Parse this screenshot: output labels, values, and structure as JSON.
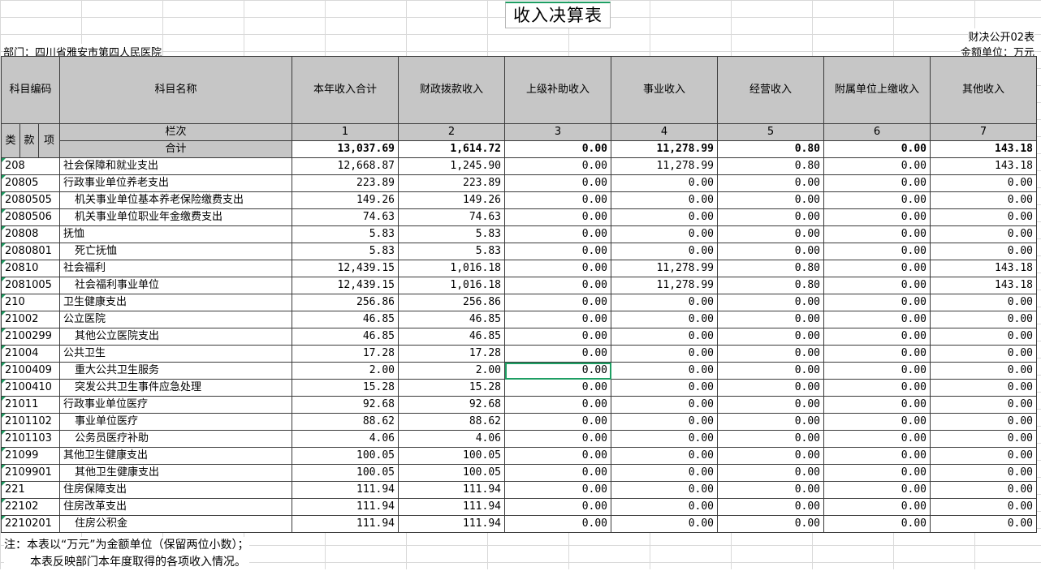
{
  "title": "收入决算表",
  "form_code": "财决公开02表",
  "department": "部门：四川省雅安市第四人民医院",
  "unit": "金额单位：万元",
  "headers": {
    "subject_code": "科目编码",
    "subject_name": "科目名称",
    "total": "本年收入合计",
    "fiscal": "财政拨款收入",
    "superior": "上级补助收入",
    "business": "事业收入",
    "operation": "经营收入",
    "affiliate": "附属单位上缴收入",
    "other": "其他收入",
    "lei": "类",
    "kuan": "款",
    "xiang": "项",
    "column_no": "栏次",
    "col1": "1",
    "col2": "2",
    "col3": "3",
    "col4": "4",
    "col5": "5",
    "col6": "6",
    "col7": "7"
  },
  "total_row": {
    "label": "合计",
    "values": [
      "13,037.69",
      "1,614.72",
      "0.00",
      "11,278.99",
      "0.80",
      "0.00",
      "143.18"
    ]
  },
  "rows": [
    {
      "code": "208",
      "name": "社会保障和就业支出",
      "indent": false,
      "values": [
        "12,668.87",
        "1,245.90",
        "0.00",
        "11,278.99",
        "0.80",
        "0.00",
        "143.18"
      ]
    },
    {
      "code": "20805",
      "name": "行政事业单位养老支出",
      "indent": false,
      "values": [
        "223.89",
        "223.89",
        "0.00",
        "0.00",
        "0.00",
        "0.00",
        "0.00"
      ]
    },
    {
      "code": "2080505",
      "name": "机关事业单位基本养老保险缴费支出",
      "indent": true,
      "values": [
        "149.26",
        "149.26",
        "0.00",
        "0.00",
        "0.00",
        "0.00",
        "0.00"
      ]
    },
    {
      "code": "2080506",
      "name": "机关事业单位职业年金缴费支出",
      "indent": true,
      "values": [
        "74.63",
        "74.63",
        "0.00",
        "0.00",
        "0.00",
        "0.00",
        "0.00"
      ]
    },
    {
      "code": "20808",
      "name": "抚恤",
      "indent": false,
      "values": [
        "5.83",
        "5.83",
        "0.00",
        "0.00",
        "0.00",
        "0.00",
        "0.00"
      ]
    },
    {
      "code": "2080801",
      "name": "死亡抚恤",
      "indent": true,
      "values": [
        "5.83",
        "5.83",
        "0.00",
        "0.00",
        "0.00",
        "0.00",
        "0.00"
      ]
    },
    {
      "code": "20810",
      "name": "社会福利",
      "indent": false,
      "values": [
        "12,439.15",
        "1,016.18",
        "0.00",
        "11,278.99",
        "0.80",
        "0.00",
        "143.18"
      ]
    },
    {
      "code": "2081005",
      "name": "社会福利事业单位",
      "indent": true,
      "values": [
        "12,439.15",
        "1,016.18",
        "0.00",
        "11,278.99",
        "0.80",
        "0.00",
        "143.18"
      ]
    },
    {
      "code": "210",
      "name": "卫生健康支出",
      "indent": false,
      "values": [
        "256.86",
        "256.86",
        "0.00",
        "0.00",
        "0.00",
        "0.00",
        "0.00"
      ]
    },
    {
      "code": "21002",
      "name": "公立医院",
      "indent": false,
      "values": [
        "46.85",
        "46.85",
        "0.00",
        "0.00",
        "0.00",
        "0.00",
        "0.00"
      ]
    },
    {
      "code": "2100299",
      "name": "其他公立医院支出",
      "indent": true,
      "values": [
        "46.85",
        "46.85",
        "0.00",
        "0.00",
        "0.00",
        "0.00",
        "0.00"
      ]
    },
    {
      "code": "21004",
      "name": "公共卫生",
      "indent": false,
      "values": [
        "17.28",
        "17.28",
        "0.00",
        "0.00",
        "0.00",
        "0.00",
        "0.00"
      ]
    },
    {
      "code": "2100409",
      "name": "重大公共卫生服务",
      "indent": true,
      "values": [
        "2.00",
        "2.00",
        "0.00",
        "0.00",
        "0.00",
        "0.00",
        "0.00"
      ]
    },
    {
      "code": "2100410",
      "name": "突发公共卫生事件应急处理",
      "indent": true,
      "values": [
        "15.28",
        "15.28",
        "0.00",
        "0.00",
        "0.00",
        "0.00",
        "0.00"
      ]
    },
    {
      "code": "21011",
      "name": "行政事业单位医疗",
      "indent": false,
      "values": [
        "92.68",
        "92.68",
        "0.00",
        "0.00",
        "0.00",
        "0.00",
        "0.00"
      ]
    },
    {
      "code": "2101102",
      "name": "事业单位医疗",
      "indent": true,
      "values": [
        "88.62",
        "88.62",
        "0.00",
        "0.00",
        "0.00",
        "0.00",
        "0.00"
      ]
    },
    {
      "code": "2101103",
      "name": "公务员医疗补助",
      "indent": true,
      "values": [
        "4.06",
        "4.06",
        "0.00",
        "0.00",
        "0.00",
        "0.00",
        "0.00"
      ]
    },
    {
      "code": "21099",
      "name": "其他卫生健康支出",
      "indent": false,
      "values": [
        "100.05",
        "100.05",
        "0.00",
        "0.00",
        "0.00",
        "0.00",
        "0.00"
      ]
    },
    {
      "code": "2109901",
      "name": "其他卫生健康支出",
      "indent": true,
      "values": [
        "100.05",
        "100.05",
        "0.00",
        "0.00",
        "0.00",
        "0.00",
        "0.00"
      ]
    },
    {
      "code": "221",
      "name": "住房保障支出",
      "indent": false,
      "values": [
        "111.94",
        "111.94",
        "0.00",
        "0.00",
        "0.00",
        "0.00",
        "0.00"
      ]
    },
    {
      "code": "22102",
      "name": "住房改革支出",
      "indent": false,
      "values": [
        "111.94",
        "111.94",
        "0.00",
        "0.00",
        "0.00",
        "0.00",
        "0.00"
      ]
    },
    {
      "code": "2210201",
      "name": "住房公积金",
      "indent": true,
      "values": [
        "111.94",
        "111.94",
        "0.00",
        "0.00",
        "0.00",
        "0.00",
        "0.00"
      ]
    }
  ],
  "notes": [
    "注：本表以“万元”为金额单位（保留两位小数）；",
    "本表反映部门本年度取得的各项收入情况。"
  ],
  "colors": {
    "header_bg": "#c6c6c6",
    "selection": "#1e9e63",
    "gridline": "#d9d9d9"
  }
}
